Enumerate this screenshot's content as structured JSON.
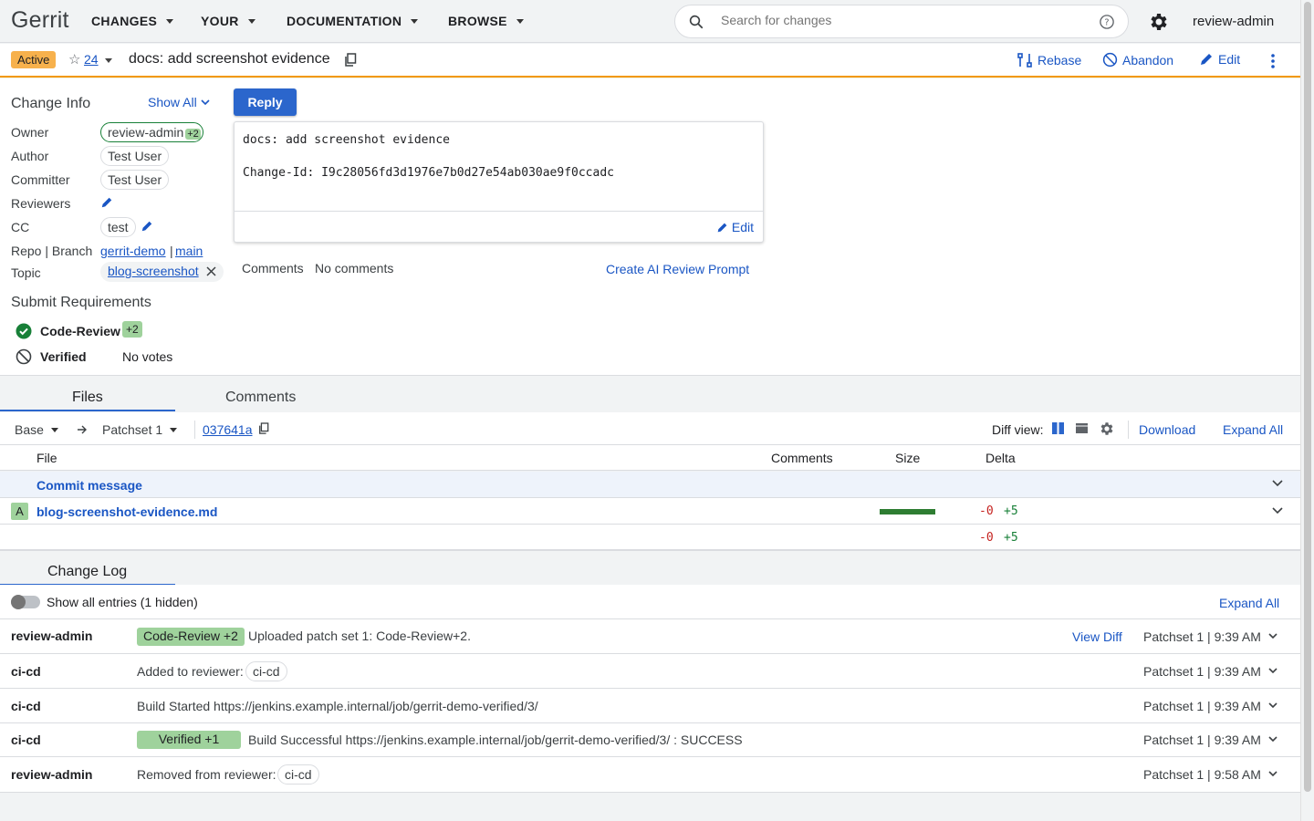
{
  "header": {
    "logo": "Gerrit",
    "nav": [
      "CHANGES",
      "YOUR",
      "DOCUMENTATION",
      "BROWSE"
    ],
    "search_placeholder": "Search for changes",
    "user": "review-admin"
  },
  "change": {
    "status": "Active",
    "number": "24",
    "subject": "docs: add screenshot evidence",
    "actions": {
      "rebase": "Rebase",
      "abandon": "Abandon",
      "edit": "Edit"
    }
  },
  "info": {
    "title": "Change Info",
    "show_all": "Show All",
    "labels": {
      "owner": "Owner",
      "author": "Author",
      "committer": "Committer",
      "reviewers": "Reviewers",
      "cc": "CC",
      "repo_branch": "Repo | Branch",
      "topic": "Topic"
    },
    "owner": "review-admin",
    "owner_vote": "+2",
    "author": "Test User",
    "committer": "Test User",
    "cc": "test",
    "repo": "gerrit-demo",
    "branch_sep": "|",
    "branch": "main",
    "topic": "blog-screenshot"
  },
  "submit": {
    "title": "Submit Requirements",
    "items": [
      {
        "name": "Code-Review",
        "vote": "+2",
        "status": "satisfied"
      },
      {
        "name": "Verified",
        "value": "No votes",
        "status": "blocked"
      }
    ]
  },
  "commit": {
    "reply": "Reply",
    "line1": "docs: add screenshot evidence",
    "line2": "Change-Id: I9c28056fd3d1976e7b0d27e54ab030ae9f0ccadc",
    "edit": "Edit",
    "comments_label": "Comments",
    "comments_value": "No comments",
    "ai_prompt": "Create AI Review Prompt"
  },
  "tabs": {
    "files": "Files",
    "comments": "Comments"
  },
  "files_toolbar": {
    "base": "Base",
    "patchset": "Patchset 1",
    "commit": "037641a",
    "diff_view": "Diff view:",
    "download": "Download",
    "expand_all": "Expand All"
  },
  "files_table": {
    "headers": {
      "file": "File",
      "comments": "Comments",
      "size": "Size",
      "delta": "Delta"
    },
    "commit_message": "Commit message",
    "files": [
      {
        "status": "A",
        "name": "blog-screenshot-evidence.md",
        "deleted": "-0",
        "added": "+5"
      }
    ],
    "total": {
      "deleted": "-0",
      "added": "+5"
    }
  },
  "change_log": {
    "title": "Change Log",
    "show_all": "Show all entries",
    "hidden": "(1 hidden)",
    "expand_all": "Expand All",
    "view_diff": "View Diff",
    "entries": [
      {
        "author": "review-admin",
        "vote": "Code-Review +2",
        "text": "Uploaded patch set 1: Code-Review+2.",
        "when": "Patchset 1 | 9:39 AM"
      },
      {
        "author": "ci-cd",
        "text": "Added to reviewer:",
        "chip": "ci-cd",
        "when": "Patchset 1 | 9:39 AM"
      },
      {
        "author": "ci-cd",
        "text": "Build Started https://jenkins.example.internal/job/gerrit-demo-verified/3/",
        "when": "Patchset 1 | 9:39 AM"
      },
      {
        "author": "ci-cd",
        "vote": "Verified +1",
        "text": "Build Successful https://jenkins.example.internal/job/gerrit-demo-verified/3/ : SUCCESS",
        "when": "Patchset 1 | 9:39 AM"
      },
      {
        "author": "review-admin",
        "text": "Removed from reviewer:",
        "chip": "ci-cd",
        "when": "Patchset 1 | 9:58 AM"
      }
    ]
  },
  "colors": {
    "accent": "#1a56c4",
    "active": "#f7b14c",
    "vote_positive": "#9fd29c",
    "status_border": "#f29900"
  }
}
